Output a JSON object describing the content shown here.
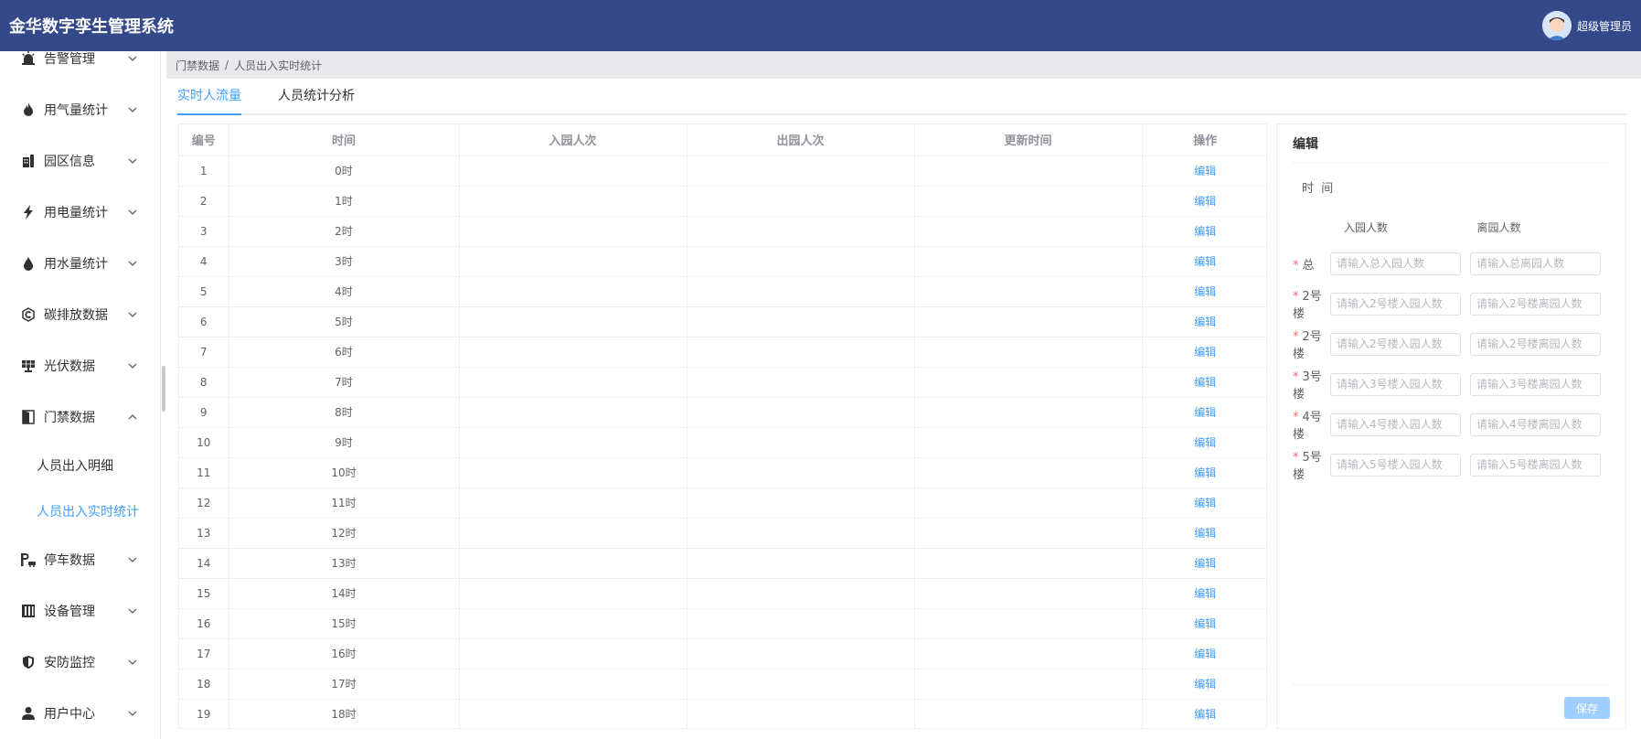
{
  "header": {
    "title": "金华数字孪生管理系统",
    "user_name": "超级管理员"
  },
  "sidebar": {
    "items": [
      {
        "label": "告警管理",
        "icon": "alarm-icon",
        "expanded": false
      },
      {
        "label": "用气量统计",
        "icon": "flame-icon",
        "expanded": false
      },
      {
        "label": "园区信息",
        "icon": "building-icon",
        "expanded": false
      },
      {
        "label": "用电量统计",
        "icon": "bolt-icon",
        "expanded": false
      },
      {
        "label": "用水量统计",
        "icon": "water-drop-icon",
        "expanded": false
      },
      {
        "label": "碳排放数据",
        "icon": "carbon-icon",
        "expanded": false
      },
      {
        "label": "光伏数据",
        "icon": "solar-panel-icon",
        "expanded": false
      },
      {
        "label": "门禁数据",
        "icon": "door-icon",
        "expanded": true
      },
      {
        "label": "停车数据",
        "icon": "parking-icon",
        "expanded": false
      },
      {
        "label": "设备管理",
        "icon": "equipment-icon",
        "expanded": false
      },
      {
        "label": "安防监控",
        "icon": "shield-icon",
        "expanded": false
      },
      {
        "label": "用户中心",
        "icon": "user-icon",
        "expanded": false
      }
    ],
    "sub_items": [
      {
        "label": "人员出入明细",
        "active": false
      },
      {
        "label": "人员出入实时统计",
        "active": true
      }
    ]
  },
  "breadcrumb": {
    "parent": "门禁数据",
    "separator": "/",
    "current": "人员出入实时统计"
  },
  "tabs": [
    {
      "label": "实时人流量",
      "active": true
    },
    {
      "label": "人员统计分析",
      "active": false
    }
  ],
  "table": {
    "columns": [
      "编号",
      "时间",
      "入园人次",
      "出园人次",
      "更新时间",
      "操作"
    ],
    "action_label": "编辑",
    "rows": [
      {
        "no": "1",
        "time": "0时",
        "in": "",
        "out": "",
        "updated": ""
      },
      {
        "no": "2",
        "time": "1时",
        "in": "",
        "out": "",
        "updated": ""
      },
      {
        "no": "3",
        "time": "2时",
        "in": "",
        "out": "",
        "updated": ""
      },
      {
        "no": "4",
        "time": "3时",
        "in": "",
        "out": "",
        "updated": ""
      },
      {
        "no": "5",
        "time": "4时",
        "in": "",
        "out": "",
        "updated": ""
      },
      {
        "no": "6",
        "time": "5时",
        "in": "",
        "out": "",
        "updated": ""
      },
      {
        "no": "7",
        "time": "6时",
        "in": "",
        "out": "",
        "updated": ""
      },
      {
        "no": "8",
        "time": "7时",
        "in": "",
        "out": "",
        "updated": ""
      },
      {
        "no": "9",
        "time": "8时",
        "in": "",
        "out": "",
        "updated": ""
      },
      {
        "no": "10",
        "time": "9时",
        "in": "",
        "out": "",
        "updated": ""
      },
      {
        "no": "11",
        "time": "10时",
        "in": "",
        "out": "",
        "updated": ""
      },
      {
        "no": "12",
        "time": "11时",
        "in": "",
        "out": "",
        "updated": ""
      },
      {
        "no": "13",
        "time": "12时",
        "in": "",
        "out": "",
        "updated": ""
      },
      {
        "no": "14",
        "time": "13时",
        "in": "",
        "out": "",
        "updated": ""
      },
      {
        "no": "15",
        "time": "14时",
        "in": "",
        "out": "",
        "updated": ""
      },
      {
        "no": "16",
        "time": "15时",
        "in": "",
        "out": "",
        "updated": ""
      },
      {
        "no": "17",
        "time": "16时",
        "in": "",
        "out": "",
        "updated": ""
      },
      {
        "no": "18",
        "time": "17时",
        "in": "",
        "out": "",
        "updated": ""
      },
      {
        "no": "19",
        "time": "18时",
        "in": "",
        "out": "",
        "updated": ""
      }
    ]
  },
  "edit_panel": {
    "title": "编辑",
    "time_label": "时  间",
    "in_header": "入园人数",
    "out_header": "离园人数",
    "fields": [
      {
        "label": "总",
        "in_placeholder": "请输入总入园人数",
        "out_placeholder": "请输入总离园人数"
      },
      {
        "label": "2号楼",
        "in_placeholder": "请输入2号楼入园人数",
        "out_placeholder": "请输入2号楼离园人数"
      },
      {
        "label": "2号楼",
        "in_placeholder": "请输入2号楼入园人数",
        "out_placeholder": "请输入2号楼离园人数"
      },
      {
        "label": "3号楼",
        "in_placeholder": "请输入3号楼入园人数",
        "out_placeholder": "请输入3号楼离园人数"
      },
      {
        "label": "4号楼",
        "in_placeholder": "请输入4号楼入园人数",
        "out_placeholder": "请输入4号楼离园人数"
      },
      {
        "label": "5号楼",
        "in_placeholder": "请输入5号楼入园人数",
        "out_placeholder": "请输入5号楼离园人数"
      }
    ],
    "save_label": "保存"
  },
  "colors": {
    "header_bg": "#33498a",
    "accent": "#409eff",
    "required": "#f56c6c",
    "save_disabled": "#a0cfff"
  }
}
